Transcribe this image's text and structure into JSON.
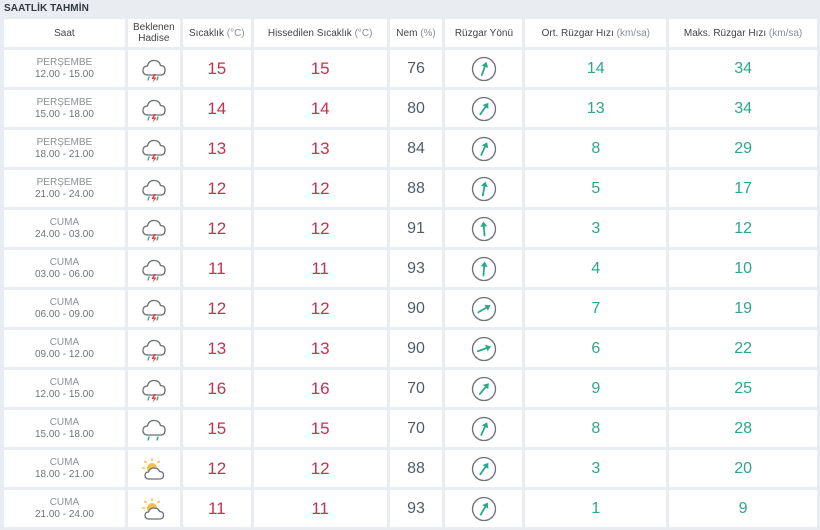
{
  "title": "SAATLİK TAHMİN",
  "headers": {
    "saat": "Saat",
    "hadise_1": "Beklenen",
    "hadise_2": "Hadise",
    "sicaklik": "Sıcaklık",
    "sicaklik_unit": "(°C)",
    "hissedilen": "Hissedilen Sıcaklık",
    "hissedilen_unit": "(°C)",
    "nem": "Nem",
    "nem_unit": "(%)",
    "ruzgar_yonu": "Rüzgar Yönü",
    "ort_ruzgar": "Ort. Rüzgar Hızı",
    "ort_ruzgar_unit": "(km/sa)",
    "maks_ruzgar": "Maks. Rüzgar Hızı",
    "maks_ruzgar_unit": "(km/sa)"
  },
  "rows": [
    {
      "day": "PERŞEMBE",
      "range": "12.00 - 15.00",
      "icon": "thunderstorm-rain-icon",
      "temp": "15",
      "feels": "15",
      "humidity": "76",
      "wind_dir_deg": 200,
      "wind_avg": "14",
      "wind_max": "34"
    },
    {
      "day": "PERŞEMBE",
      "range": "15.00 - 18.00",
      "icon": "thunderstorm-rain-icon",
      "temp": "14",
      "feels": "14",
      "humidity": "80",
      "wind_dir_deg": 215,
      "wind_avg": "13",
      "wind_max": "34"
    },
    {
      "day": "PERŞEMBE",
      "range": "18.00 - 21.00",
      "icon": "thunderstorm-rain-icon",
      "temp": "13",
      "feels": "13",
      "humidity": "84",
      "wind_dir_deg": 205,
      "wind_avg": "8",
      "wind_max": "29"
    },
    {
      "day": "PERŞEMBE",
      "range": "21.00 - 24.00",
      "icon": "thunderstorm-rain-icon",
      "temp": "12",
      "feels": "12",
      "humidity": "88",
      "wind_dir_deg": 190,
      "wind_avg": "5",
      "wind_max": "17"
    },
    {
      "day": "CUMA",
      "range": "24.00 - 03.00",
      "icon": "thunderstorm-rain-icon",
      "temp": "12",
      "feels": "12",
      "humidity": "91",
      "wind_dir_deg": 175,
      "wind_avg": "3",
      "wind_max": "12"
    },
    {
      "day": "CUMA",
      "range": "03.00 - 06.00",
      "icon": "thunderstorm-rain-icon",
      "temp": "11",
      "feels": "11",
      "humidity": "93",
      "wind_dir_deg": 185,
      "wind_avg": "4",
      "wind_max": "10"
    },
    {
      "day": "CUMA",
      "range": "06.00 - 09.00",
      "icon": "thunderstorm-rain-icon",
      "temp": "12",
      "feels": "12",
      "humidity": "90",
      "wind_dir_deg": 240,
      "wind_avg": "7",
      "wind_max": "19"
    },
    {
      "day": "CUMA",
      "range": "09.00 - 12.00",
      "icon": "thunderstorm-rain-icon",
      "temp": "13",
      "feels": "13",
      "humidity": "90",
      "wind_dir_deg": 250,
      "wind_avg": "6",
      "wind_max": "22"
    },
    {
      "day": "CUMA",
      "range": "12.00 - 15.00",
      "icon": "thunderstorm-rain-icon",
      "temp": "16",
      "feels": "16",
      "humidity": "70",
      "wind_dir_deg": 220,
      "wind_avg": "9",
      "wind_max": "25"
    },
    {
      "day": "CUMA",
      "range": "15.00 - 18.00",
      "icon": "rain-cloud-icon",
      "temp": "15",
      "feels": "15",
      "humidity": "70",
      "wind_dir_deg": 205,
      "wind_avg": "8",
      "wind_max": "28"
    },
    {
      "day": "CUMA",
      "range": "18.00 - 21.00",
      "icon": "partly-cloudy-icon",
      "temp": "12",
      "feels": "12",
      "humidity": "88",
      "wind_dir_deg": 215,
      "wind_avg": "3",
      "wind_max": "20"
    },
    {
      "day": "CUMA",
      "range": "21.00 - 24.00",
      "icon": "partly-cloudy-icon",
      "temp": "11",
      "feels": "11",
      "humidity": "93",
      "wind_dir_deg": 210,
      "wind_avg": "1",
      "wind_max": "9"
    }
  ],
  "colors": {
    "temp": "#c2334f",
    "wind": "#2aa88a",
    "humidity": "#555b62"
  }
}
